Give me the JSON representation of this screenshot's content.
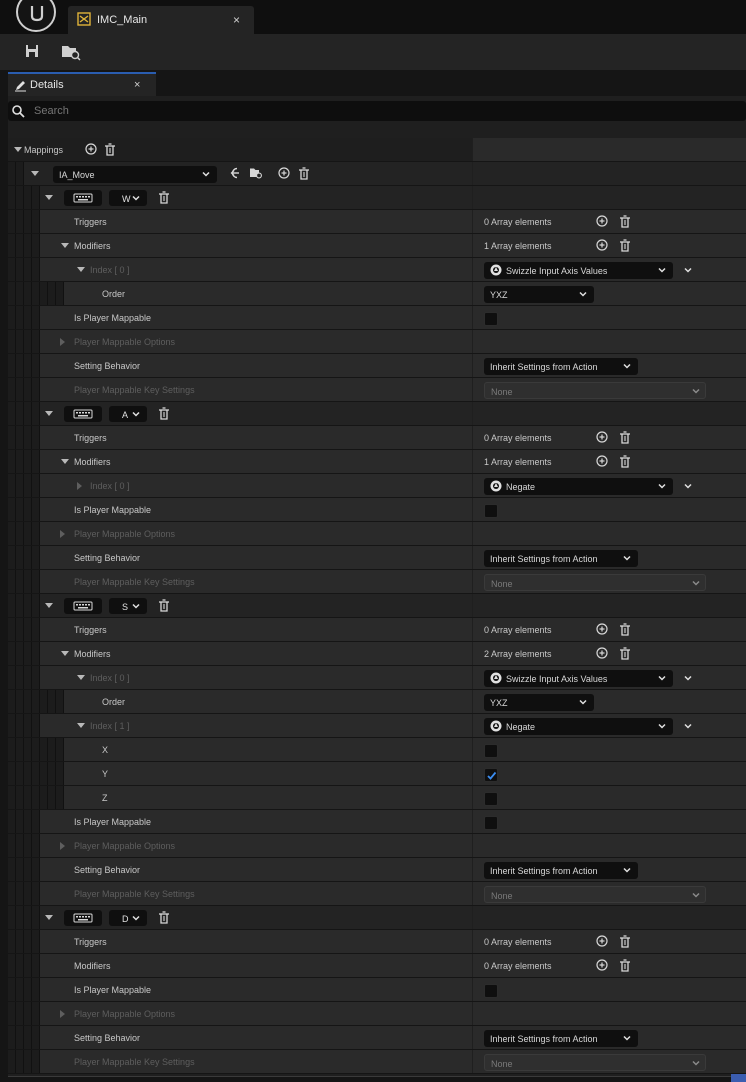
{
  "window": {
    "tab_label": "IMC_Main",
    "tab_close": "×"
  },
  "details": {
    "tab_label": "Details",
    "tab_close": "×",
    "search_placeholder": "Search"
  },
  "mappings_label": "Mappings",
  "action": {
    "name": "IA_Move"
  },
  "texts": {
    "triggers": "Triggers",
    "modifiers": "Modifiers",
    "is_player_mappable": "Is Player Mappable",
    "player_mappable_options": "Player Mappable Options",
    "setting_behavior": "Setting Behavior",
    "player_mappable_key_settings": "Player Mappable Key Settings",
    "order": "Order"
  },
  "keys": [
    {
      "key": "W",
      "triggers_value": "0 Array elements",
      "modifiers_value": "1 Array elements",
      "modifiers": [
        {
          "index_label": "Index [ 0 ]",
          "type": "Swizzle Input Axis Values",
          "order": "YXZ"
        }
      ],
      "is_player_mappable": false,
      "setting_behavior": "Inherit Settings from Action",
      "key_settings": "None"
    },
    {
      "key": "A",
      "triggers_value": "0 Array elements",
      "modifiers_value": "1 Array elements",
      "modifiers": [
        {
          "index_label": "Index [ 0 ]",
          "type": "Negate"
        }
      ],
      "is_player_mappable": false,
      "setting_behavior": "Inherit Settings from Action",
      "key_settings": "None"
    },
    {
      "key": "S",
      "triggers_value": "0 Array elements",
      "modifiers_value": "2 Array elements",
      "modifiers": [
        {
          "index_label": "Index [ 0 ]",
          "type": "Swizzle Input Axis Values",
          "order": "YXZ"
        },
        {
          "index_label": "Index [ 1 ]",
          "type": "Negate",
          "axes": [
            {
              "name": "X",
              "checked": false
            },
            {
              "name": "Y",
              "checked": true
            },
            {
              "name": "Z",
              "checked": false
            }
          ]
        }
      ],
      "is_player_mappable": false,
      "setting_behavior": "Inherit Settings from Action",
      "key_settings": "None"
    },
    {
      "key": "D",
      "triggers_value": "0 Array elements",
      "modifiers_value": "0 Array elements",
      "modifiers": [],
      "is_player_mappable": false,
      "setting_behavior": "Inherit Settings from Action",
      "key_settings": "None"
    }
  ],
  "colors": {
    "accent": "#2a5db0",
    "checkbox_check": "#3b8cf0",
    "panel_bg": "#1f1f1f",
    "row_bg": "#2a2a2a"
  }
}
